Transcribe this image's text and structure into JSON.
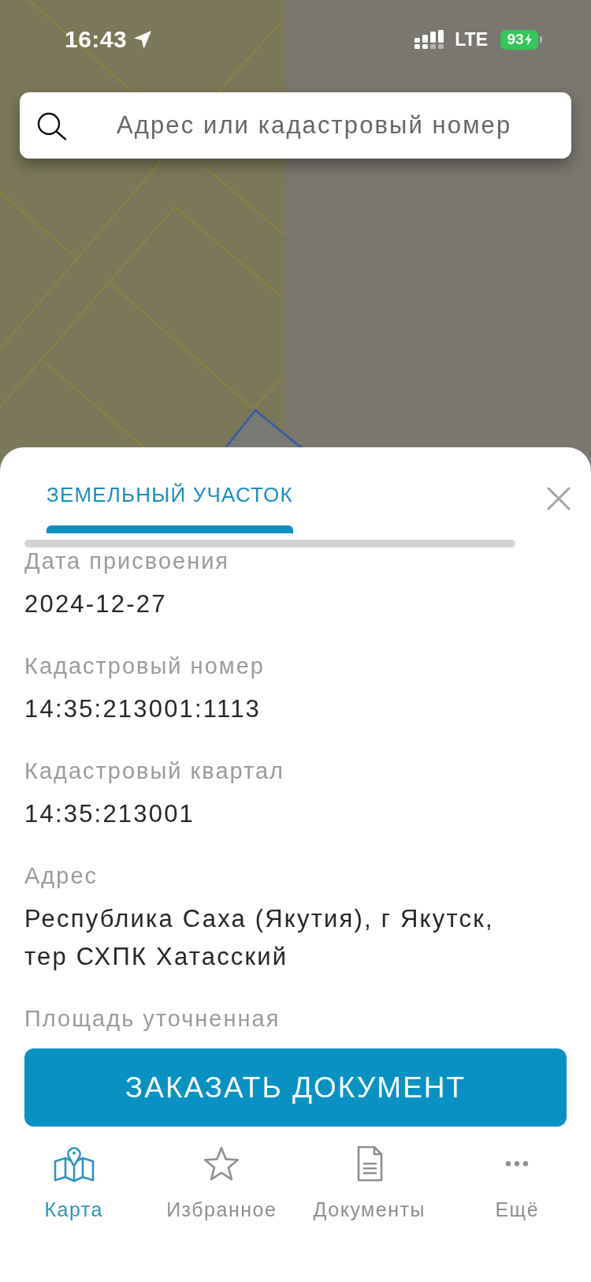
{
  "status_bar": {
    "time": "16:43",
    "network": "LTE",
    "battery": "93",
    "charging": true
  },
  "search": {
    "placeholder": "Адрес или кадастровый номер"
  },
  "sheet": {
    "tabs": [
      {
        "label": "ЗЕМЕЛЬНЫЙ УЧАСТОК",
        "selected": true
      }
    ],
    "fields": [
      {
        "label": "Дата присвоения",
        "value": "2024-12-27"
      },
      {
        "label": "Кадастровый номер",
        "value": "14:35:213001:1113"
      },
      {
        "label": "Кадастровый квартал",
        "value": "14:35:213001"
      },
      {
        "label": "Адрес",
        "value": "Республика Саха (Якутия), г Якутск, тер СХПК Хатасский"
      },
      {
        "label": "Площадь уточненная"
      }
    ],
    "action_button": {
      "label": "ЗАКАЗАТЬ ДОКУМЕНТ"
    }
  },
  "bottom_nav": [
    {
      "kind": "map",
      "label": "Карта",
      "selected": true
    },
    {
      "kind": "star",
      "label": "Избранное",
      "selected": false
    },
    {
      "kind": "document",
      "label": "Документы",
      "selected": false
    },
    {
      "kind": "more",
      "label": "Ещё",
      "selected": false
    }
  ]
}
